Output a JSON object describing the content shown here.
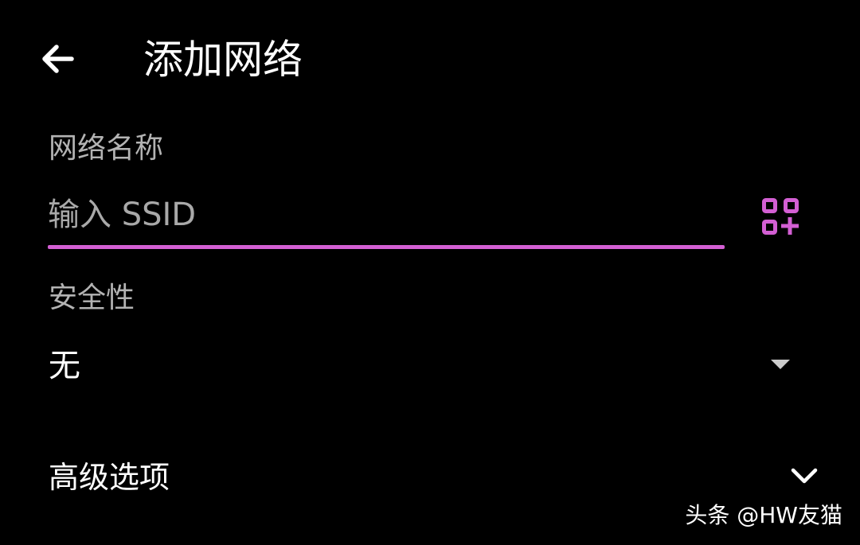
{
  "header": {
    "title": "添加网络"
  },
  "network_name": {
    "label": "网络名称",
    "value": "",
    "placeholder": "输入 SSID"
  },
  "security": {
    "label": "安全性",
    "selected": "无"
  },
  "advanced": {
    "label": "高级选项"
  },
  "watermark": {
    "text": "头条 @HW友猫"
  },
  "icons": {
    "back": "arrow-left-icon",
    "qr_scan": "qr-code-icon",
    "dropdown": "triangle-down-icon",
    "expand": "chevron-down-icon"
  },
  "colors": {
    "background": "#000000",
    "accent": "#d35fd3",
    "text_primary": "#ffffff",
    "text_secondary": "#b3b3b3",
    "dropdown_icon": "#cccccc"
  }
}
